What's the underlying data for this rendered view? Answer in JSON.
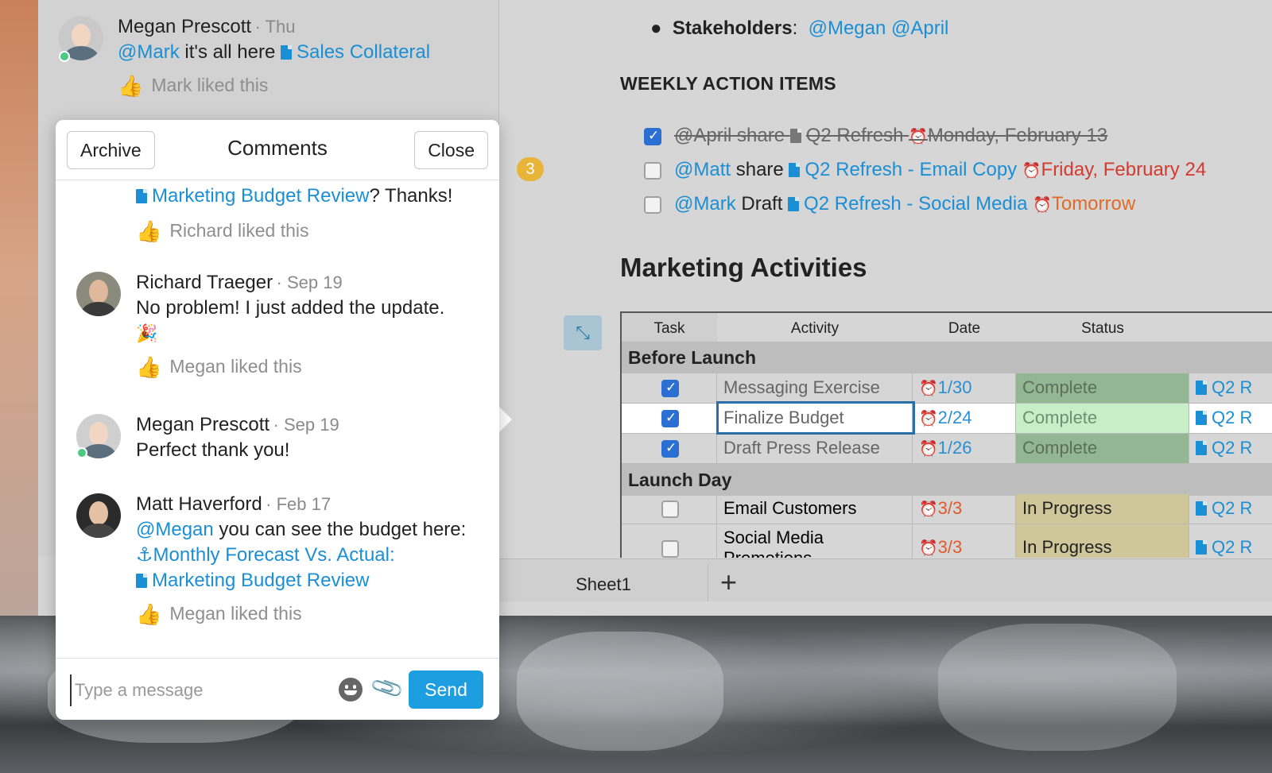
{
  "feed": {
    "author": "Megan Prescott",
    "time": "· Thu",
    "mention": "@Mark",
    "text": " it's all here ",
    "link": "Sales Collateral",
    "liked": "Mark liked this"
  },
  "document": {
    "stakeholders_label": "Stakeholders",
    "stakeholders_colon": ":",
    "stakeholders_mentions": "@Megan @April",
    "weekly_heading": "WEEKLY ACTION ITEMS",
    "comment_count": "3",
    "action_items": [
      {
        "mention": "@April",
        "verb": " share ",
        "doc": "Q2 Refresh",
        "due": "Monday, February 13",
        "done": true
      },
      {
        "mention": "@Matt",
        "verb": " share ",
        "doc": "Q2 Refresh - Email Copy",
        "due": "Friday, February 24",
        "done": false
      },
      {
        "mention": "@Mark",
        "verb": " Draft ",
        "doc": "Q2 Refresh - Social Media",
        "due": "Tomorrow",
        "done": false
      }
    ],
    "activities_heading": "Marketing Activities",
    "table": {
      "headers": [
        "Task",
        "Activity",
        "Date",
        "Status"
      ],
      "groups": [
        {
          "name": "Before Launch",
          "rows": [
            {
              "done": true,
              "activity": "Messaging Exercise",
              "date": "1/30",
              "status": "Complete",
              "doc": "Q2 R"
            },
            {
              "done": true,
              "activity": "Finalize Budget",
              "date": "2/24",
              "status": "Complete",
              "doc": "Q2 R"
            },
            {
              "done": true,
              "activity": "Draft Press Release",
              "date": "1/26",
              "status": "Complete",
              "doc": "Q2 R"
            }
          ]
        },
        {
          "name": "Launch Day",
          "rows": [
            {
              "done": false,
              "activity": "Email Customers",
              "date": "3/3",
              "status": "In Progress",
              "doc": "Q2 R"
            },
            {
              "done": false,
              "activity": "Social Media Promotions",
              "date": "3/3",
              "status": "In Progress",
              "doc": "Q2 R"
            }
          ]
        }
      ]
    },
    "sheet_tab": "Sheet1",
    "add_sheet": "+"
  },
  "comments": {
    "archive": "Archive",
    "title": "Comments",
    "close": "Close",
    "partial": {
      "link": "Marketing Budget Review",
      "text": "? Thanks!",
      "liked": "Richard liked this"
    },
    "items": [
      {
        "author": "Richard Traeger",
        "time": "· Sep 19",
        "text": "No problem! I just added the update.",
        "emoji": "🎉",
        "liked": "Megan liked this"
      },
      {
        "author": "Megan Prescott",
        "time": "· Sep 19",
        "text": "Perfect thank you!"
      },
      {
        "author": "Matt Haverford",
        "time": "· Feb 17",
        "mention": "@Megan",
        "text": " you can see the budget here:",
        "link1": "Monthly Forecast Vs. Actual:",
        "link2": "Marketing Budget Review",
        "liked": "Megan liked this"
      }
    ],
    "input_placeholder": "Type a message",
    "send": "Send"
  },
  "icons": {
    "like": "thumbs-up-icon",
    "doc": "document-icon",
    "alarm": "alarm-clock-icon",
    "expand": "expand-icon",
    "emoji": "emoji-icon",
    "attach": "paperclip-icon"
  },
  "colors": {
    "link": "#1b8fd6",
    "send": "#1d9ee0",
    "complete": "#93b793",
    "progress": "#cfc69a",
    "overdue": "#d63a2f",
    "badge": "#e8b43a"
  }
}
